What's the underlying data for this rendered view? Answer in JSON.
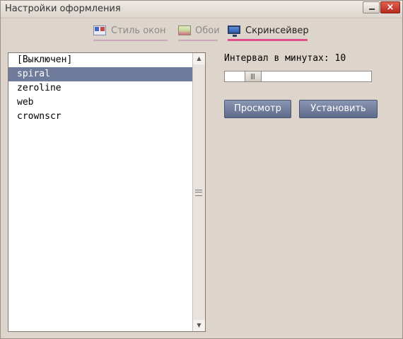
{
  "window": {
    "title": "Настройки оформления",
    "close_glyph": "×"
  },
  "tabs": [
    {
      "label": "Стиль окон",
      "icon": "window-style-icon",
      "active": false
    },
    {
      "label": "Обои",
      "icon": "wallpaper-icon",
      "active": false
    },
    {
      "label": "Скринсейвер",
      "icon": "monitor-icon",
      "active": true
    }
  ],
  "screensaver_list": {
    "items": [
      "[Выключен]",
      "spiral",
      "zeroline",
      "web",
      "crownscr"
    ],
    "selected": "spiral"
  },
  "interval": {
    "label": "Интервал в минутах: 10",
    "minutes": 10
  },
  "buttons": {
    "preview": "Просмотр",
    "install": "Установить"
  },
  "colors": {
    "selection": "#6e7b9a",
    "active_tab_underline": "#e0508c",
    "button": "#6e7b9a"
  }
}
